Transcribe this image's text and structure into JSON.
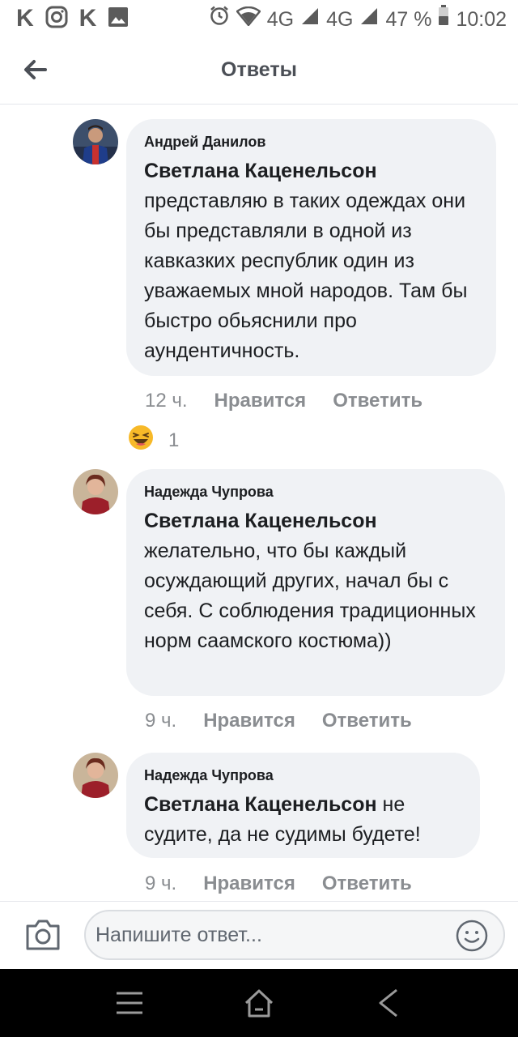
{
  "status_bar": {
    "left_icons": [
      "K",
      "instagram-icon",
      "K",
      "image-icon"
    ],
    "network1": "4G",
    "network2": "4G",
    "battery": "47 %",
    "time": "10:02"
  },
  "header": {
    "title": "Ответы"
  },
  "comments": [
    {
      "author": "Андрей Данилов",
      "mention": "Светлана Каценельсон",
      "text": "представляю в таких одеждах они бы представляли в одной из кавказких республик один из уважаемых мной народов. Там бы быстро обьяснили про аундентичность.",
      "time": "12 ч.",
      "like_label": "Нравится",
      "reply_label": "Ответить",
      "reaction": {
        "icon": "laughing-emoji-icon",
        "count": "1"
      }
    },
    {
      "author": "Надежда Чупрова",
      "mention": "Светлана Каценельсон",
      "text": "желательно, что бы каждый осуждающий  других, начал бы с себя. С соблюдения традиционных норм саамского костюма))",
      "time": "9 ч.",
      "like_label": "Нравится",
      "reply_label": "Ответить"
    },
    {
      "author": "Надежда Чупрова",
      "mention": "Светлана Каценельсон",
      "text": "не судите, да не судимы будете!",
      "time": "9 ч.",
      "like_label": "Нравится",
      "reply_label": "Ответить"
    }
  ],
  "composer": {
    "placeholder": "Напишите ответ..."
  },
  "colors": {
    "bubble": "#f0f2f5",
    "meta_text": "#8a8d91",
    "navbar": "#000000"
  }
}
